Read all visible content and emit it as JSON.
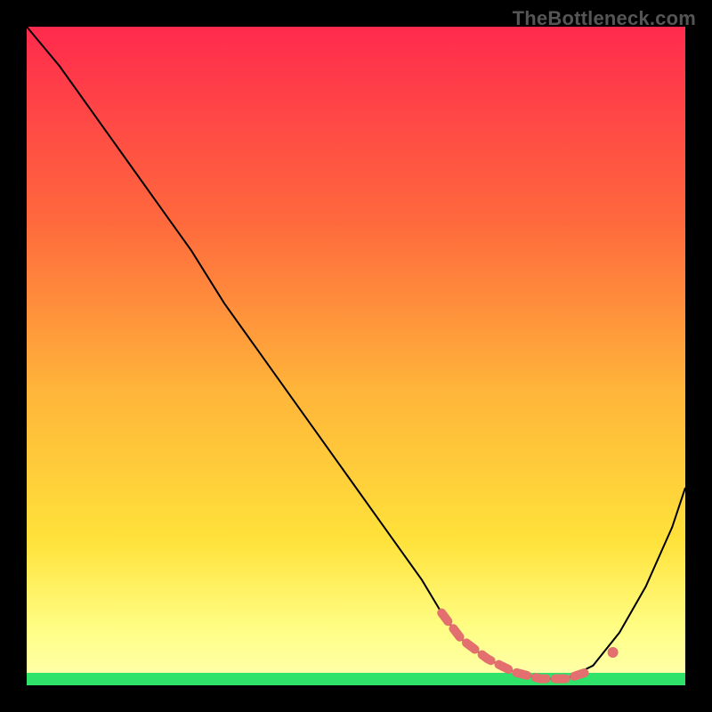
{
  "watermark": "TheBottleneck.com",
  "chart_data": {
    "type": "line",
    "title": "",
    "xlabel": "",
    "ylabel": "",
    "xlim": [
      0,
      100
    ],
    "ylim": [
      0,
      100
    ],
    "grid": false,
    "legend": false,
    "background_gradient": {
      "top": "#ff2a4d",
      "mid1": "#ff7a3a",
      "mid2": "#ffe23a",
      "bottom_band": "#ffff9a",
      "base_stripe": "#2fe36a"
    },
    "series": [
      {
        "name": "curve",
        "x": [
          0,
          5,
          10,
          15,
          20,
          25,
          30,
          35,
          40,
          45,
          50,
          55,
          60,
          63,
          66,
          70,
          74,
          78,
          82,
          86,
          90,
          94,
          98,
          100
        ],
        "y": [
          100,
          94,
          87,
          80,
          73,
          66,
          58,
          51,
          44,
          37,
          30,
          23,
          16,
          11,
          7,
          4,
          2,
          1,
          1,
          3,
          8,
          15,
          24,
          30
        ]
      }
    ],
    "highlight": {
      "name": "optimal-region",
      "x": [
        63,
        66,
        70,
        74,
        78,
        82,
        85
      ],
      "y": [
        11,
        7,
        4,
        2,
        1,
        1,
        2
      ],
      "extra_dot": {
        "x": 89,
        "y": 5
      }
    }
  }
}
